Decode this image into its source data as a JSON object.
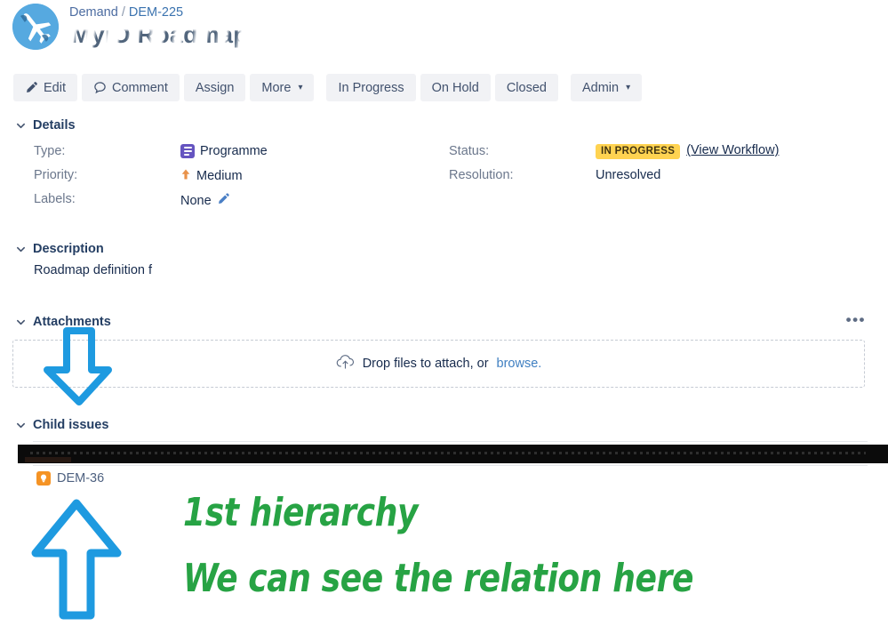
{
  "header": {
    "avatar_icon": "airplane-avatar-icon",
    "breadcrumb": {
      "project": "Demand",
      "separator": "/",
      "issue_key": "DEM-225"
    },
    "issue_title": "MyiO Roadmap"
  },
  "toolbar": {
    "edit_label": "Edit",
    "edit_icon": "pencil-icon",
    "comment_label": "Comment",
    "comment_icon": "speech-bubble-icon",
    "assign_label": "Assign",
    "more_label": "More",
    "more_icon": "chevron-down-icon",
    "in_progress_label": "In Progress",
    "on_hold_label": "On Hold",
    "closed_label": "Closed",
    "admin_label": "Admin",
    "admin_icon": "chevron-down-icon"
  },
  "details": {
    "section_title": "Details",
    "caret_icon": "chevron-down-icon",
    "type_label": "Type:",
    "type_value": "Programme",
    "type_icon": "programme-icon",
    "priority_label": "Priority:",
    "priority_value": "Medium",
    "priority_icon": "priority-medium-up-arrow-icon",
    "labels_label": "Labels:",
    "labels_value": "None",
    "labels_edit_icon": "pencil-icon",
    "status_label": "Status:",
    "status_value": "IN PROGRESS",
    "status_color": "#ffd351",
    "workflow_link": "(View Workflow)",
    "resolution_label": "Resolution:",
    "resolution_value": "Unresolved"
  },
  "description": {
    "section_title": "Description",
    "caret_icon": "chevron-down-icon",
    "body": "Roadmap definition f"
  },
  "attachments": {
    "section_title": "Attachments",
    "caret_icon": "chevron-down-icon",
    "more_menu": "•••",
    "dropzone_text": "Drop files to attach, or",
    "dropzone_link": "browse.",
    "dropzone_icon": "cloud-upload-icon"
  },
  "child_issues": {
    "section_title": "Child issues",
    "caret_icon": "chevron-down-icon",
    "redacted_row": "",
    "rows": [
      {
        "icon": "story-lightbulb-icon",
        "key": "DEM-36"
      }
    ]
  },
  "annotations": {
    "color": "#27a344",
    "arrow_color": "#1e9ae0",
    "down_arrow_icon": "down-arrow-annotation-icon",
    "up_arrow_icon": "up-arrow-annotation-icon",
    "line1": "1st hierarchy",
    "line2": "We can see the relation here"
  }
}
